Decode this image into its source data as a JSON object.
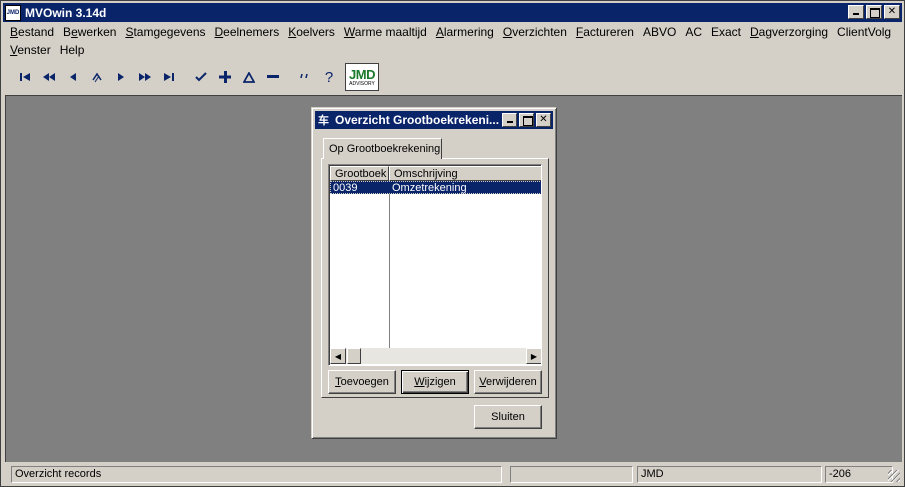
{
  "app": {
    "title": "MVOwin 3.14d",
    "logo_text": "JMD"
  },
  "menu": [
    {
      "pre": "",
      "ul": "B",
      "post": "estand"
    },
    {
      "pre": "B",
      "ul": "e",
      "post": "werken"
    },
    {
      "pre": "",
      "ul": "S",
      "post": "tamgegevens"
    },
    {
      "pre": "",
      "ul": "D",
      "post": "eelnemers"
    },
    {
      "pre": "",
      "ul": "K",
      "post": "oelvers"
    },
    {
      "pre": "",
      "ul": "W",
      "post": "arme maaltijd"
    },
    {
      "pre": "",
      "ul": "A",
      "post": "larmering"
    },
    {
      "pre": "",
      "ul": "O",
      "post": "verzichten"
    },
    {
      "pre": "",
      "ul": "F",
      "post": "actureren"
    },
    {
      "pre": "",
      "ul": "",
      "post": "ABVO"
    },
    {
      "pre": "",
      "ul": "",
      "post": "AC"
    },
    {
      "pre": "",
      "ul": "",
      "post": "Exact"
    },
    {
      "pre": "",
      "ul": "D",
      "post": "agverzorging"
    },
    {
      "pre": "",
      "ul": "",
      "post": "ClientVolg"
    },
    {
      "pre": "",
      "ul": "V",
      "post": "enster"
    },
    {
      "pre": "",
      "ul": "",
      "post": "Help"
    }
  ],
  "toolbar": {
    "logo_big": "JMD",
    "logo_small": "ADVISORY"
  },
  "dialog": {
    "title": "Overzicht Grootboekrekeni...",
    "tab_label": "Op Grootboekrekening",
    "columns": [
      "Grootboek",
      "Omschrijving"
    ],
    "rows": [
      {
        "code": "0039",
        "description": "Omzetrekening"
      }
    ],
    "btn_add": {
      "ul": "T",
      "post": "oevoegen"
    },
    "btn_edit": {
      "ul": "W",
      "post": "ijzigen"
    },
    "btn_delete": {
      "pre": "",
      "ul": "V",
      "post": "erwijderen"
    },
    "btn_close": "Sluiten"
  },
  "status": {
    "text": "Overzicht records",
    "panel2": "",
    "user": "JMD",
    "number": "-206"
  }
}
